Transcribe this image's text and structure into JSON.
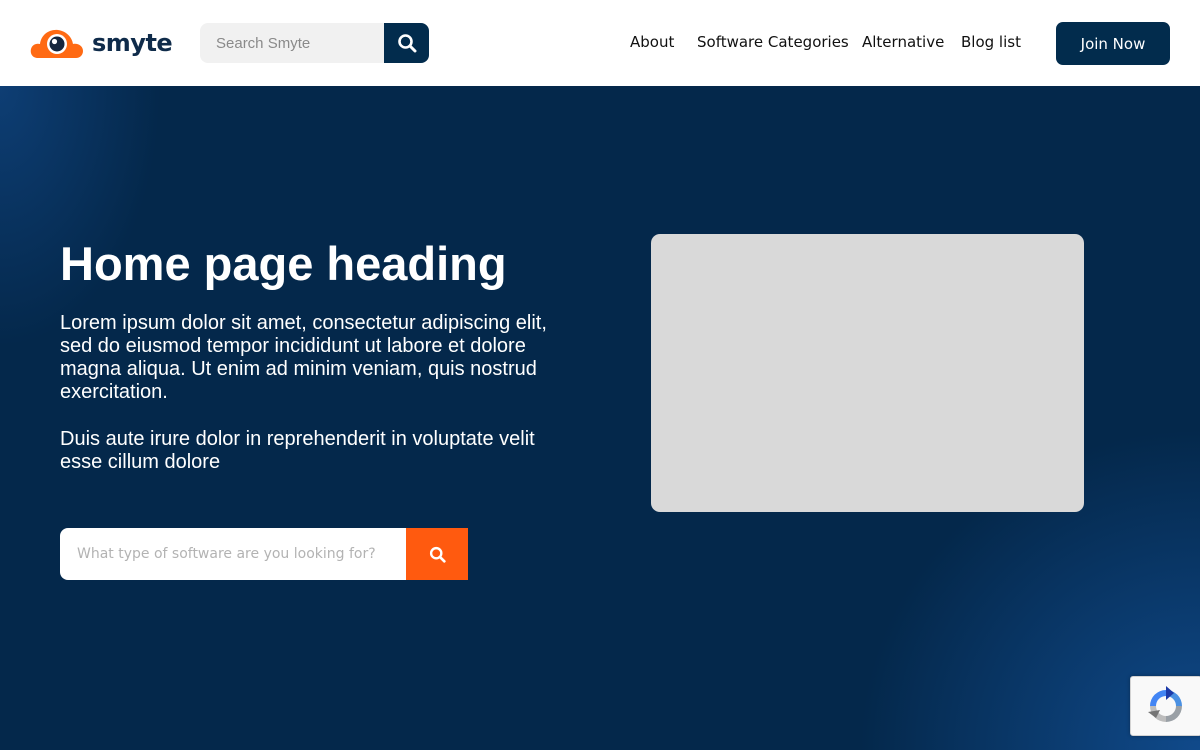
{
  "brand": {
    "name": "smyte",
    "logo_colors": {
      "cloud": "#ff6a13",
      "eye": "#16263d"
    }
  },
  "header": {
    "search": {
      "placeholder": "Search Smyte",
      "icon": "search-icon"
    },
    "nav": [
      {
        "label": "About"
      },
      {
        "label": "Software Categories"
      },
      {
        "label": "Alternative"
      },
      {
        "label": "Blog list"
      }
    ],
    "join_label": "Join Now"
  },
  "hero": {
    "title": "Home page heading",
    "paragraph1": "Lorem ipsum dolor sit amet, consectetur adipiscing elit, sed do eiusmod tempor incididunt ut labore et dolore magna aliqua. Ut enim ad minim veniam, quis nostrud exercitation.",
    "paragraph2": "Duis aute irure dolor in reprehenderit in voluptate velit esse cillum dolore",
    "search": {
      "placeholder": "What type of software are you looking for?",
      "icon": "search-icon"
    },
    "media": {
      "icon": "image-placeholder"
    }
  },
  "recaptcha": {
    "icon": "recaptcha-icon"
  },
  "colors": {
    "primary": "#022c4d",
    "accent": "#ff5a0f",
    "hero_bg": "#04284b",
    "placeholder_gray": "#d9d9d9"
  }
}
